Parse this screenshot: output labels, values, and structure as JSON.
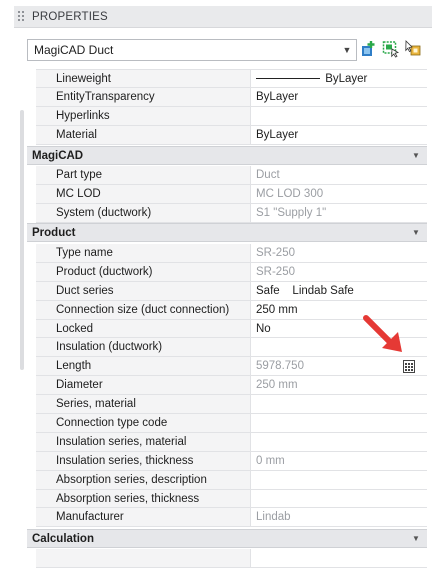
{
  "palette": {
    "title_bar": "#e9eaec",
    "section_bg": "#e6e7ea",
    "readonly_text": "#9b9ea3",
    "annotation_arrow": "#e53935"
  },
  "panel": {
    "title": "PROPERTIES"
  },
  "selector": {
    "value": "MagiCAD Duct",
    "icons": [
      "quick-select-icon",
      "select-objects-icon",
      "toggle-pickadd-icon"
    ]
  },
  "top_rows": [
    {
      "name": "Lineweight",
      "value": "ByLayer",
      "line": true
    },
    {
      "name": "EntityTransparency",
      "value": "ByLayer"
    },
    {
      "name": "Hyperlinks",
      "value": ""
    },
    {
      "name": "Material",
      "value": "ByLayer"
    }
  ],
  "sections": {
    "magicad": {
      "label": "MagiCAD",
      "rows": [
        {
          "name": "Part type",
          "value": "Duct"
        },
        {
          "name": "MC LOD",
          "value": "MC LOD 300"
        },
        {
          "name": "System (ductwork)",
          "value": "S1 \"Supply 1\""
        }
      ]
    },
    "product": {
      "label": "Product",
      "rows": [
        {
          "name": "Type name",
          "value": "SR-250"
        },
        {
          "name": "Product (ductwork)",
          "value": "SR-250"
        },
        {
          "name": "Duct series",
          "value": "Safe    Lindab Safe"
        },
        {
          "name": "Connection size (duct connection)",
          "value": "250 mm"
        },
        {
          "name": "Locked",
          "value": "No"
        },
        {
          "name": "Insulation (ductwork)",
          "value": ""
        },
        {
          "name": "Length",
          "value": "5978.750"
        },
        {
          "name": "Diameter",
          "value": "250 mm"
        },
        {
          "name": "Series, material",
          "value": ""
        },
        {
          "name": "Connection type code",
          "value": ""
        },
        {
          "name": "Insulation series, material",
          "value": ""
        },
        {
          "name": "Insulation series, thickness",
          "value": "0 mm"
        },
        {
          "name": "Absorption series, description",
          "value": ""
        },
        {
          "name": "Absorption series, thickness",
          "value": ""
        },
        {
          "name": "Manufacturer",
          "value": "Lindab"
        }
      ]
    },
    "calculation": {
      "label": "Calculation"
    }
  }
}
